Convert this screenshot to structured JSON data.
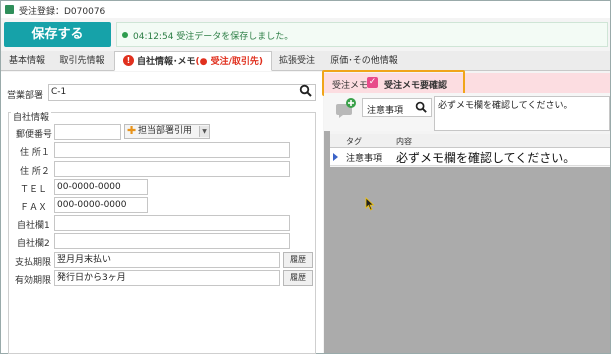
{
  "window": {
    "title": "受注登録：D070076"
  },
  "toolbar": {
    "save_label": "保存する",
    "status_message": "04:12:54 受注データを保存しました。"
  },
  "tabs": [
    {
      "label": "基本情報"
    },
    {
      "label": "取引先情報"
    },
    {
      "label": "自社情報･メモ",
      "sub_label": "(● 受注/取引先)"
    },
    {
      "label": "拡張受注"
    },
    {
      "label": "原価･その他情報"
    }
  ],
  "left": {
    "dept_label": "営業部署",
    "dept_value": "C-1",
    "group_title": "自社情報",
    "postal_label": "郵便番号",
    "postal_value": "",
    "assign_button": "担当部署引用",
    "address1_label": "住 所１",
    "address1_value": "",
    "address2_label": "住 所２",
    "address2_value": "",
    "tel_label": "ＴＥＬ",
    "tel_value": "00-0000-0000",
    "fax_label": "ＦＡＸ",
    "fax_value": "000-0000-0000",
    "custom1_label": "自社欄1",
    "custom1_value": "",
    "custom2_label": "自社欄2",
    "custom2_value": "",
    "payment_label": "支払期限",
    "payment_value": "翌月月末払い",
    "validity_label": "有効期限",
    "validity_value": "発行日から3ヶ月",
    "history_label": "履歴"
  },
  "memo": {
    "section_label": "受注メモ",
    "check_label": "受注メモ要確認",
    "check_mark": "✓",
    "checked": true,
    "type_value": "注意事項",
    "text_value": "必ずメモ欄を確認してください。",
    "grid_headers": [
      "タグ",
      "内容"
    ],
    "rows": [
      {
        "tag": "注意事項",
        "content": "必ずメモ欄を確認してください。"
      }
    ]
  },
  "colors": {
    "save_button": "#16a2a9",
    "status_text": "#2b7d44",
    "active_tab_sub": "#e0301e",
    "memo_highlight": "#f0a51a",
    "memo_check": "#e84a8a"
  },
  "icons": {
    "warning": "warning-icon",
    "search": "search-icon",
    "add_memo": "add-memo-icon",
    "plus": "plus-icon"
  }
}
